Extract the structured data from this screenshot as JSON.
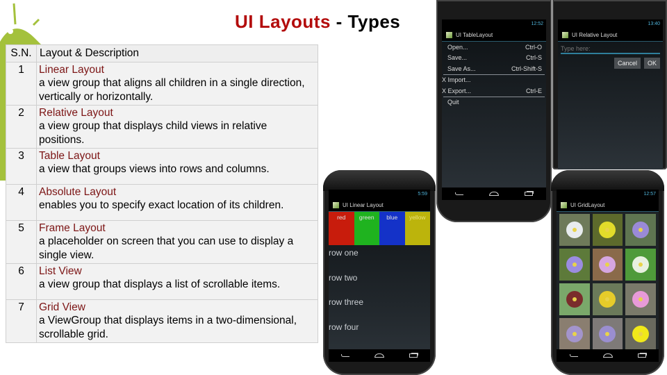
{
  "slide": {
    "title_highlight": "UI Layouts",
    "title_rest": " - Types"
  },
  "table": {
    "headers": {
      "sn": "S.N.",
      "desc": "Layout & Description"
    },
    "rows": [
      {
        "sn": "1",
        "name": "Linear Layout",
        "desc": "a view group that aligns all children in a single direction, vertically or horizontally."
      },
      {
        "sn": "2",
        "name": "Relative Layout",
        "desc": "a view group that displays child views in relative positions."
      },
      {
        "sn": "3",
        "name": "Table Layout",
        "desc": "a view that groups views into rows and columns."
      },
      {
        "sn": "4",
        "name": "Absolute Layout",
        "desc": "enables you to specify exact location of its children."
      },
      {
        "sn": "5",
        "name": "Frame Layout",
        "desc": "a placeholder on screen that you can use to display a single view."
      },
      {
        "sn": "6",
        "name": "List View",
        "desc": "a view group that displays a list of scrollable items."
      },
      {
        "sn": "7",
        "name": "Grid View",
        "desc": "a ViewGroup that displays items in a two-dimensional, scrollable grid."
      }
    ]
  },
  "phones": {
    "table_layout": {
      "time": "12:52",
      "app_title": "UI TableLayout",
      "menu": [
        {
          "label": "Open...",
          "shortcut": "Ctrl-O",
          "indent": true
        },
        {
          "label": "Save...",
          "shortcut": "Ctrl-S",
          "indent": true
        },
        {
          "label": "Save As...",
          "shortcut": "Ctrl-Shift-S",
          "indent": true
        },
        {
          "label": "X Import...",
          "shortcut": "",
          "indent": false
        },
        {
          "label": "X Export...",
          "shortcut": "Ctrl-E",
          "indent": false
        },
        {
          "label": "Quit",
          "shortcut": "",
          "indent": true
        }
      ]
    },
    "relative_layout": {
      "time": "13:40",
      "app_title": "UI Relative Layout",
      "input_placeholder": "Type here:",
      "cancel_label": "Cancel",
      "ok_label": "OK"
    },
    "linear_layout": {
      "time": "5:59",
      "app_title": "UI Linear Layout",
      "colors": [
        {
          "label": "red",
          "color": "#c81c0c"
        },
        {
          "label": "green",
          "color": "#1fb31f"
        },
        {
          "label": "blue",
          "color": "#1432c8"
        },
        {
          "label": "yellow",
          "color": "#bcb40c"
        }
      ],
      "rows": [
        "row one",
        "row two",
        "row three",
        "row four"
      ]
    },
    "grid_layout": {
      "time": "12:57",
      "app_title": "UI GridLayout",
      "flowers": [
        {
          "name": "white-flower",
          "bg": "#6e7a5a",
          "petal": "#e8ecef"
        },
        {
          "name": "yellow-flower",
          "bg": "#5d6a2c",
          "petal": "#e2dc2a"
        },
        {
          "name": "purple-flower",
          "bg": "#5f7551",
          "petal": "#9a8ad8"
        },
        {
          "name": "lilac-flower",
          "bg": "#5d7a3a",
          "petal": "#9b8ce0"
        },
        {
          "name": "pink-flower",
          "bg": "#8a6a4a",
          "petal": "#d6a6e0"
        },
        {
          "name": "white-small-flower",
          "bg": "#4f9a3a",
          "petal": "#e8f0e0"
        },
        {
          "name": "red-bud-flower",
          "bg": "#7aa86a",
          "petal": "#7a2c2c"
        },
        {
          "name": "thistle-flower",
          "bg": "#6b7a5a",
          "petal": "#e6cc2a"
        },
        {
          "name": "rose-flower",
          "bg": "#7a7a6a",
          "petal": "#e89ad8"
        },
        {
          "name": "lavender-flower",
          "bg": "#8a7e70",
          "petal": "#a394cc"
        },
        {
          "name": "sage-flower",
          "bg": "#7e7a78",
          "petal": "#9a8ed0"
        },
        {
          "name": "buttercup-flower",
          "bg": "#6a6a5e",
          "petal": "#f0e81a"
        }
      ]
    }
  }
}
